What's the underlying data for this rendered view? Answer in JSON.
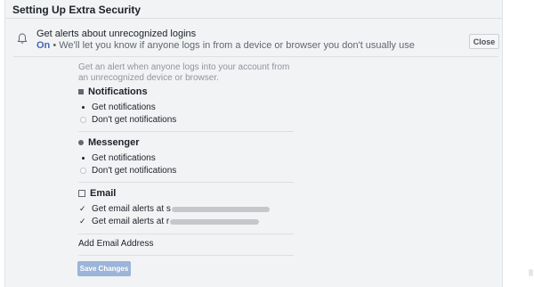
{
  "panel": {
    "title": "Setting Up Extra Security"
  },
  "alerts": {
    "title": "Get alerts about unrecognized logins",
    "status_on": "On",
    "status_text": " • We'll let you know if anyone logs in from a device or browser you don't usually use",
    "close_label": "Close"
  },
  "description": "Get an alert when anyone logs into your account from an unrecognized device or browser.",
  "notifications": {
    "heading": "Notifications",
    "options": [
      "Get notifications",
      "Don't get notifications"
    ]
  },
  "messenger": {
    "heading": "Messenger",
    "options": [
      "Get notifications",
      "Don't get notifications"
    ]
  },
  "email": {
    "heading": "Email",
    "options": [
      "Get email alerts at s",
      "Get email alerts at r"
    ],
    "add_label": "Add Email Address"
  },
  "save_label": "Save Changes",
  "icons": {
    "bell": "bell-icon",
    "notifications": "notifications-icon",
    "messenger": "messenger-icon",
    "email": "email-icon"
  },
  "colors": {
    "link": "#4267b2",
    "save_disabled": "#9cb4d8"
  }
}
